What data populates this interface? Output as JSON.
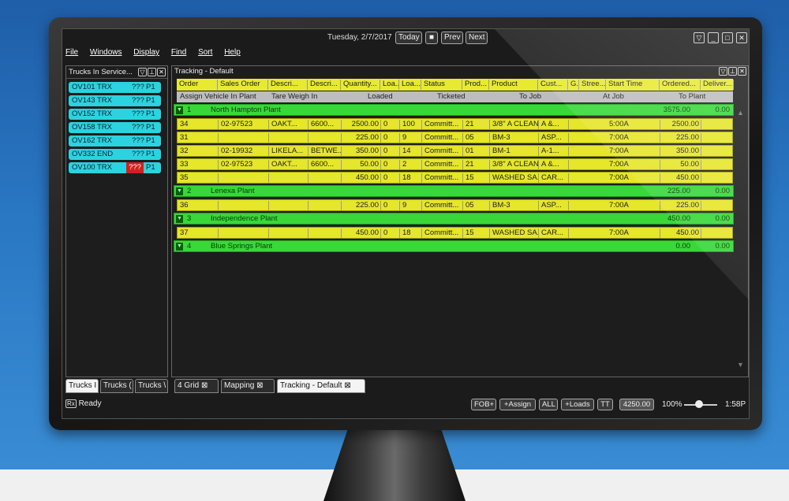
{
  "titlebar": {
    "date": "Tuesday, 2/7/2017",
    "today": "Today",
    "stop": "■",
    "prev": "Prev",
    "next": "Next"
  },
  "window_controls": {
    "filter": "▽",
    "minimize": "_",
    "maximize": "□",
    "close": "✕"
  },
  "menu": [
    "File",
    "Windows",
    "Display",
    "Find",
    "Sort",
    "Help"
  ],
  "trucks_pane": {
    "title": "Trucks In Service...",
    "trucks": [
      {
        "id": "OV101",
        "code": "TRX",
        "q": "???",
        "p": "P1",
        "alert": false
      },
      {
        "id": "OV143",
        "code": "TRX",
        "q": "???",
        "p": "P1",
        "alert": false
      },
      {
        "id": "OV152",
        "code": "TRX",
        "q": "???",
        "p": "P1",
        "alert": false
      },
      {
        "id": "OV158",
        "code": "TRX",
        "q": "???",
        "p": "P1",
        "alert": false
      },
      {
        "id": "OV162",
        "code": "TRX",
        "q": "???",
        "p": "P1",
        "alert": false
      },
      {
        "id": "OV332",
        "code": "END",
        "q": "???",
        "p": "P1",
        "alert": false
      },
      {
        "id": "OV100",
        "code": "TRX",
        "q": "???",
        "p": "P1",
        "alert": true
      }
    ]
  },
  "tracking": {
    "title": "Tracking - Default",
    "columns": [
      "Order",
      "Sales Order",
      "Descri...",
      "Descri...",
      "Quantity...",
      "Loa...",
      "Loa...",
      "Status",
      "Prod...",
      "Product",
      "Cust...",
      "G...",
      "Stree...",
      "Start Time",
      "Ordered...",
      "Deliver..."
    ],
    "subheaders": [
      "Assign Vehicle In Plant",
      "Tare Weigh In",
      "Loaded",
      "Ticketed",
      "To Job",
      "At Job",
      "To Plant"
    ],
    "groups": [
      {
        "num": "1",
        "name": "North Hampton Plant",
        "ordered": "3575.00",
        "delivered": "0.00",
        "rows": [
          {
            "order": "34",
            "so": "02-97523",
            "d1": "OAKT...",
            "d2": "6600...",
            "qty": "2500.00",
            "l1": "0",
            "l2": "100",
            "status": "Committ...",
            "prod": "21",
            "product": "3/8\" A CLEAN",
            "cust": "A &...",
            "time": "5:00A",
            "ordered": "2500.00"
          },
          {
            "order": "31",
            "so": "",
            "d1": "",
            "d2": "",
            "qty": "225.00",
            "l1": "0",
            "l2": "9",
            "status": "Committ...",
            "prod": "05",
            "product": "BM-3",
            "cust": "ASP...",
            "time": "7:00A",
            "ordered": "225.00"
          },
          {
            "order": "32",
            "so": "02-19932",
            "d1": "LIKELA...",
            "d2": "BETWE...",
            "qty": "350.00",
            "l1": "0",
            "l2": "14",
            "status": "Committ...",
            "prod": "01",
            "product": "BM-1",
            "cust": "A-1...",
            "time": "7:00A",
            "ordered": "350.00"
          },
          {
            "order": "33",
            "so": "02-97523",
            "d1": "OAKT...",
            "d2": "6600...",
            "qty": "50.00",
            "l1": "0",
            "l2": "2",
            "status": "Committ...",
            "prod": "21",
            "product": "3/8\" A CLEAN",
            "cust": "A &...",
            "time": "7:00A",
            "ordered": "50.00"
          },
          {
            "order": "35",
            "so": "",
            "d1": "",
            "d2": "",
            "qty": "450.00",
            "l1": "0",
            "l2": "18",
            "status": "Committ...",
            "prod": "15",
            "product": "WASHED SA...",
            "cust": "CAR...",
            "time": "7:00A",
            "ordered": "450.00"
          }
        ]
      },
      {
        "num": "2",
        "name": "Lenexa Plant",
        "ordered": "225.00",
        "delivered": "0.00",
        "rows": [
          {
            "order": "36",
            "so": "",
            "d1": "",
            "d2": "",
            "qty": "225.00",
            "l1": "0",
            "l2": "9",
            "status": "Committ...",
            "prod": "05",
            "product": "BM-3",
            "cust": "ASP...",
            "time": "7:00A",
            "ordered": "225.00"
          }
        ]
      },
      {
        "num": "3",
        "name": "Independence Plant",
        "ordered": "450.00",
        "delivered": "0.00",
        "rows": [
          {
            "order": "37",
            "so": "",
            "d1": "",
            "d2": "",
            "qty": "450.00",
            "l1": "0",
            "l2": "18",
            "status": "Committ...",
            "prod": "15",
            "product": "WASHED SA...",
            "cust": "CAR...",
            "time": "7:00A",
            "ordered": "450.00"
          }
        ]
      },
      {
        "num": "4",
        "name": "Blue Springs Plant",
        "ordered": "0.00",
        "delivered": "0.00",
        "rows": []
      }
    ]
  },
  "left_tabs": [
    "Trucks I",
    "Trucks (",
    "Trucks \\"
  ],
  "main_tabs": [
    "4 Grid",
    "Mapping",
    "Tracking - Default"
  ],
  "status": {
    "rx": "Rx",
    "ready": "Ready",
    "buttons": [
      "FOB+",
      "+Assign",
      "ALL",
      "+Loads",
      "TT"
    ],
    "total": "4250.00",
    "zoom": "100%",
    "time": "1:58P"
  },
  "colors": {
    "row": "#e6e62a",
    "group": "#38d838",
    "truck": "#2bd3e0",
    "alert": "#d02020"
  }
}
